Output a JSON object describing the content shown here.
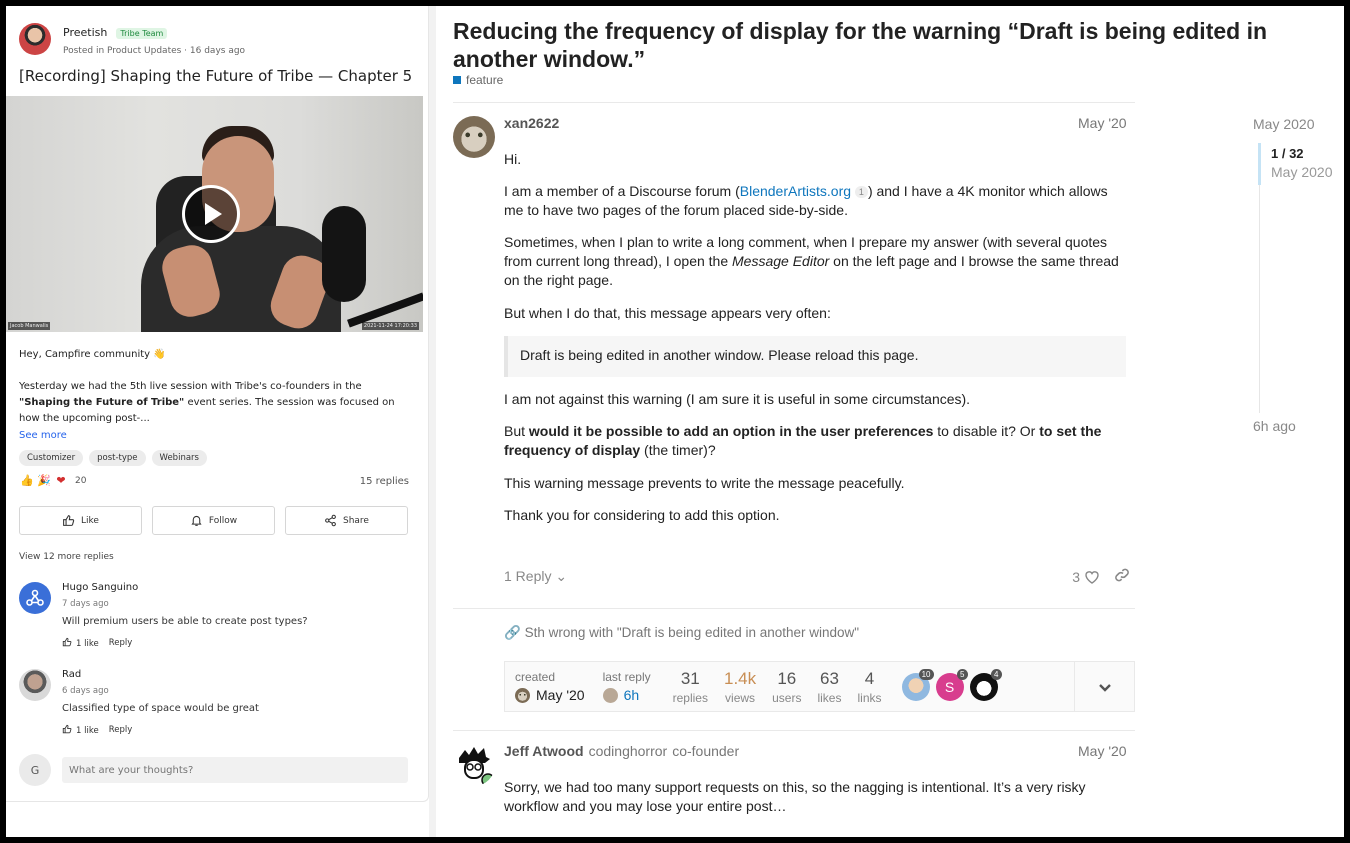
{
  "left_panel": {
    "author": "Preetish",
    "author_badge": "Tribe Team",
    "posted": "Posted in Product Updates · 16 days ago",
    "title": "[Recording] Shaping the Future of Tribe — Chapter 5",
    "video": {
      "left_tag": "Jacob Manwalis",
      "right_tag": "2021-11-24 17:20:33"
    },
    "greeting": "Hey, Campfire community 👋",
    "body_1": "Yesterday we had the 5th live session with Tribe's co-founders in the ",
    "body_bold": "\"Shaping the Future of Tribe\"",
    "body_2": " event series. The session was focused on how the upcoming post-...",
    "see_more": "See more",
    "tags": [
      "Customizer",
      "post-type",
      "Webinars"
    ],
    "reaction_count": "20",
    "replies": "15 replies",
    "actions": {
      "like": "Like",
      "follow": "Follow",
      "share": "Share"
    },
    "view_more": "View 12 more replies",
    "comments": [
      {
        "name": "Hugo Sanguino",
        "time": "7 days ago",
        "text": "Will premium users be able to create post types?",
        "likes": "1 like",
        "reply": "Reply"
      },
      {
        "name": "Rad",
        "time": "6 days ago",
        "text": "Classified type of space would be great",
        "likes": "1 like",
        "reply": "Reply"
      }
    ],
    "reply_avatar": "G",
    "reply_placeholder": "What are your thoughts?"
  },
  "topic": {
    "title": "Reducing the frequency of display for the warning “Draft is being edited in another window.”",
    "category": "feature",
    "category_color": "#0e76bd"
  },
  "post1": {
    "user": "xan2622",
    "date": "May '20",
    "p1": "Hi.",
    "p2a": "I am a member of a Discourse forum (",
    "p2_link": "BlenderArtists.org",
    "p2_link_count": "1",
    "p2b": ") and I have a 4K monitor which allows me to have two pages of the forum placed side-by-side.",
    "p3a": "Sometimes, when I plan to write a long comment, when I prepare my answer (with several quotes from current long thread), I open the ",
    "p3_em": "Message Editor",
    "p3b": " on the left page and I browse the same thread on the right page.",
    "p4": "But when I do that, this message appears very often:",
    "quote": "Draft is being edited in another window. Please reload this page.",
    "p5": "I am not against this warning (I am sure it is useful in some circumstances).",
    "p6a": "But ",
    "p6_b1": "would it be possible to add an option in the user preferences",
    "p6b": " to disable it? Or ",
    "p6_b2": "to set the frequency of display",
    "p6c": " (the timer)?",
    "p7": "This warning message prevents to write the message peacefully.",
    "p8": "Thank you for considering to add this option.",
    "reply_label": "1 Reply",
    "like_count": "3"
  },
  "linked_topic": "Sth wrong with \"Draft is being edited in another window\"",
  "topic_map": {
    "created_label": "created",
    "created_date": "May '20",
    "last_reply_label": "last reply",
    "last_reply_time": "6h",
    "stats": [
      {
        "num": "31",
        "label": "replies"
      },
      {
        "num": "1.4k",
        "label": "views"
      },
      {
        "num": "16",
        "label": "users"
      },
      {
        "num": "63",
        "label": "likes"
      },
      {
        "num": "4",
        "label": "links"
      }
    ],
    "participants": [
      "10",
      "5",
      "4"
    ],
    "participant_letter": "S"
  },
  "post2": {
    "user": "Jeff Atwood",
    "username": "codinghorror",
    "title": "co-founder",
    "date": "May '20",
    "text": "Sorry, we had too many support requests on this, so the nagging is intentional. It’s a very risky workflow and you may lose your entire post…"
  },
  "timeline": {
    "top": "May 2020",
    "position": "1 / 32",
    "position_date": "May 2020",
    "bottom": "6h ago"
  }
}
